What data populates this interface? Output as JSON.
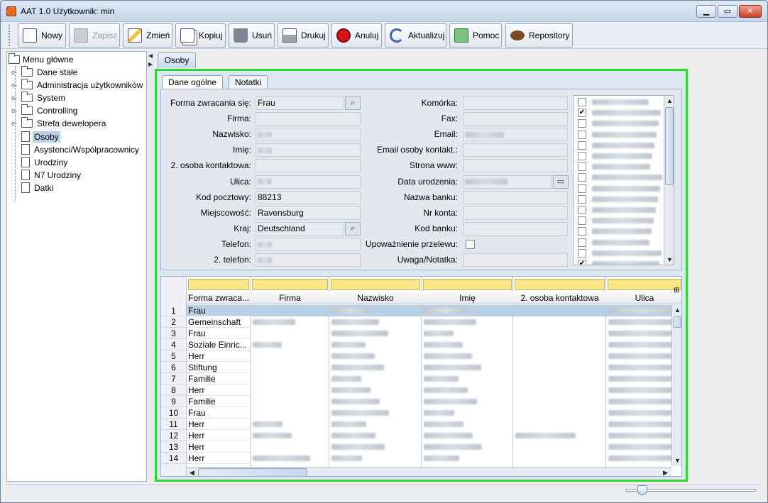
{
  "window": {
    "title": "AAT 1.0  Użytkownik: min"
  },
  "toolbar": [
    {
      "name": "new",
      "label": "Nowy",
      "icon": "new-document-icon",
      "enabled": true
    },
    {
      "name": "save",
      "label": "Zapisz",
      "icon": "save-icon",
      "enabled": false
    },
    {
      "name": "edit",
      "label": "Zmień",
      "icon": "pencil-icon",
      "enabled": true
    },
    {
      "name": "copy",
      "label": "Kopiuj",
      "icon": "copy-icon",
      "enabled": true
    },
    {
      "name": "delete",
      "label": "Usuń",
      "icon": "trash-icon",
      "enabled": true
    },
    {
      "name": "print",
      "label": "Drukuj",
      "icon": "printer-icon",
      "enabled": true
    },
    {
      "name": "cancel",
      "label": "Anuluj",
      "icon": "stop-icon",
      "enabled": true
    },
    {
      "name": "refresh",
      "label": "Aktualizuj",
      "icon": "refresh-icon",
      "enabled": true
    },
    {
      "name": "help",
      "label": "Pomoc",
      "icon": "help-icon",
      "enabled": true
    },
    {
      "name": "repository",
      "label": "Repository",
      "icon": "bean-icon",
      "enabled": true
    }
  ],
  "tree": {
    "root": "Menu główne",
    "items": [
      {
        "label": "Dane stałe",
        "type": "folder"
      },
      {
        "label": "Administracja użytkowników",
        "type": "folder"
      },
      {
        "label": "System",
        "type": "folder"
      },
      {
        "label": "Controlling",
        "type": "folder"
      },
      {
        "label": "Strefa dewelopera",
        "type": "folder"
      },
      {
        "label": "Osoby",
        "type": "doc",
        "selected": true
      },
      {
        "label": "Asystenci/Współpracownicy",
        "type": "doc"
      },
      {
        "label": "Urodziny",
        "type": "doc"
      },
      {
        "label": "N7 Urodziny",
        "type": "doc"
      },
      {
        "label": "Datki",
        "type": "doc"
      }
    ]
  },
  "main_tab": "Osoby",
  "sub_tabs": [
    "Dane ogólne",
    "Notatki"
  ],
  "form": {
    "left": [
      {
        "label": "Forma zwracania się:",
        "value": "Frau",
        "picker": true
      },
      {
        "label": "Firma:",
        "value": ""
      },
      {
        "label": "Nazwisko:",
        "value": "",
        "redacted": true
      },
      {
        "label": "Imię:",
        "value": "",
        "redacted": true
      },
      {
        "label": "2. osoba kontaktowa:",
        "value": ""
      },
      {
        "label": "Ulica:",
        "value": "",
        "redacted": true
      },
      {
        "label": "Kod pocztowy:",
        "value": "88213"
      },
      {
        "label": "Miejscowość:",
        "value": "Ravensburg"
      },
      {
        "label": "Kraj:",
        "value": "Deutschland",
        "picker": true
      },
      {
        "label": "Telefon:",
        "value": "",
        "redacted": true
      },
      {
        "label": "2. telefon:",
        "value": "",
        "redacted": true
      }
    ],
    "right": [
      {
        "label": "Komórka:",
        "value": ""
      },
      {
        "label": "Fax:",
        "value": ""
      },
      {
        "label": "Email:",
        "value": "",
        "redacted": true
      },
      {
        "label": "Email osoby kontakt.:",
        "value": ""
      },
      {
        "label": "Strona www:",
        "value": ""
      },
      {
        "label": "Data urodzenia:",
        "value": "",
        "redacted": true,
        "picker": true
      },
      {
        "label": "Nazwa banku:",
        "value": ""
      },
      {
        "label": "Nr konta:",
        "value": ""
      },
      {
        "label": "Kod banku:",
        "value": ""
      },
      {
        "label": "Upoważnienie przelewu:",
        "checkbox": true,
        "checked": false
      },
      {
        "label": "Uwaga/Notatka:",
        "value": ""
      }
    ],
    "checklist": [
      false,
      true,
      false,
      false,
      false,
      false,
      false,
      false,
      false,
      false,
      false,
      false,
      false,
      false,
      false,
      true,
      false
    ]
  },
  "grid": {
    "columns": [
      "Forma zwraca...",
      "Firma",
      "Nazwisko",
      "Imię",
      "2. osoba kontaktowa",
      "Ulica"
    ],
    "rows": [
      {
        "n": "1",
        "forma": "Frau"
      },
      {
        "n": "2",
        "forma": "Gemeinschaft"
      },
      {
        "n": "3",
        "forma": "Frau"
      },
      {
        "n": "4",
        "forma": "Soziale Einric..."
      },
      {
        "n": "5",
        "forma": "Herr"
      },
      {
        "n": "6",
        "forma": "Stiftung"
      },
      {
        "n": "7",
        "forma": "Familie"
      },
      {
        "n": "8",
        "forma": "Herr"
      },
      {
        "n": "9",
        "forma": "Familie"
      },
      {
        "n": "10",
        "forma": "Frau"
      },
      {
        "n": "11",
        "forma": "Herr"
      },
      {
        "n": "12",
        "forma": "Herr"
      },
      {
        "n": "13",
        "forma": "Herr"
      },
      {
        "n": "14",
        "forma": "Herr"
      }
    ]
  },
  "colors": {
    "accent_border": "#2ed82e",
    "selected_row": "#b8cfe5",
    "filter_row": "#fde58a"
  }
}
